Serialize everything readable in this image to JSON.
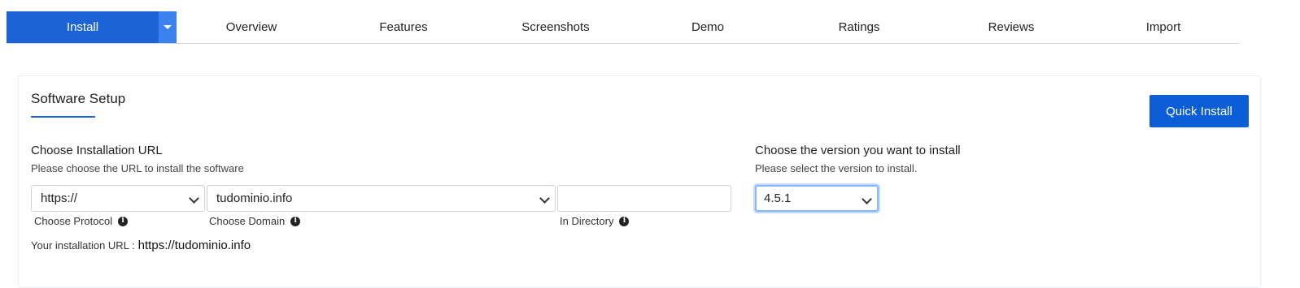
{
  "tabs": {
    "active": "Install",
    "items": [
      "Overview",
      "Features",
      "Screenshots",
      "Demo",
      "Ratings",
      "Reviews",
      "Import"
    ]
  },
  "setup": {
    "title": "Software Setup",
    "quick_install_label": "Quick Install"
  },
  "install_url": {
    "heading": "Choose Installation URL",
    "description": "Please choose the URL to install the software",
    "protocol": {
      "value": "https://",
      "label": "Choose Protocol"
    },
    "domain": {
      "value": "tudominio.info",
      "label": "Choose Domain"
    },
    "directory": {
      "value": "",
      "label": "In Directory"
    },
    "summary_label": "Your installation URL :",
    "summary_value": "https://tudominio.info"
  },
  "version": {
    "heading": "Choose the version you want to install",
    "description": "Please select the version to install.",
    "value": "4.5.1"
  },
  "colors": {
    "accent": "#1d63d8",
    "caret_bg": "#3b82ee",
    "button": "#0b5ed7"
  }
}
